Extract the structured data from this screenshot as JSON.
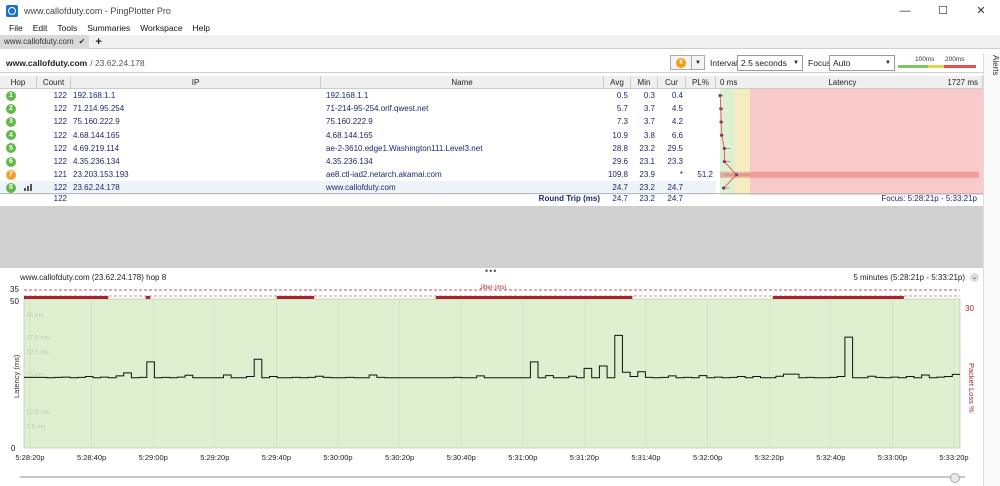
{
  "window": {
    "title": "www.callofduty.com - PingPlotter Pro",
    "minimize": "—",
    "maximize": "☐",
    "close": "✕"
  },
  "menu": [
    "File",
    "Edit",
    "Tools",
    "Summaries",
    "Workspace",
    "Help"
  ],
  "tab": {
    "label": "www.callofduty.com",
    "add": "+"
  },
  "target": {
    "name": "www.callofduty.com",
    "ip": " / 23.62.24.178"
  },
  "controls": {
    "interval_label": "Interval",
    "interval_value": "2.5 seconds",
    "focus_label": "Focus",
    "focus_value": "Auto",
    "scale_100": "100ms",
    "scale_200": "200ms",
    "alerts": "Alerts"
  },
  "table": {
    "headers": {
      "hop": "Hop",
      "count": "Count",
      "ip": "IP",
      "name": "Name",
      "avg": "Avg",
      "min": "Min",
      "cur": "Cur",
      "pl": "PL%",
      "lat0": "0 ms",
      "latency": "Latency",
      "latmax": "1727 ms"
    },
    "rows": [
      {
        "hop": "1",
        "count": "122",
        "ip": "192.168.1.1",
        "name": "192.168.1.1",
        "avg": "0.5",
        "min": "0.3",
        "cur": "0.4",
        "pl": "",
        "status": "ok"
      },
      {
        "hop": "2",
        "count": "122",
        "ip": "71.214.95.254",
        "name": "71-214-95-254.orlf.qwest.net",
        "avg": "5.7",
        "min": "3.7",
        "cur": "4.5",
        "pl": "",
        "status": "ok"
      },
      {
        "hop": "3",
        "count": "122",
        "ip": "75.160.222.9",
        "name": "75.160.222.9",
        "avg": "7.3",
        "min": "3.7",
        "cur": "4.2",
        "pl": "",
        "status": "ok"
      },
      {
        "hop": "4",
        "count": "122",
        "ip": "4.68.144.165",
        "name": "4.68.144.165",
        "avg": "10.9",
        "min": "3.8",
        "cur": "6.6",
        "pl": "",
        "status": "ok"
      },
      {
        "hop": "5",
        "count": "122",
        "ip": "4.69.219.114",
        "name": "ae-2-3610.edge1.Washington111.Level3.net",
        "avg": "28.8",
        "min": "23.2",
        "cur": "29.5",
        "pl": "",
        "status": "ok"
      },
      {
        "hop": "6",
        "count": "122",
        "ip": "4.35.236.134",
        "name": "4.35.236.134",
        "avg": "29.6",
        "min": "23.1",
        "cur": "23.3",
        "pl": "",
        "status": "ok"
      },
      {
        "hop": "7",
        "count": "121",
        "ip": "23.203.153.193",
        "name": "ae8.ctl-iad2.netarch.akamai.com",
        "avg": "109.8",
        "min": "23.9",
        "cur": "*",
        "pl": "51.2",
        "status": "warn"
      },
      {
        "hop": "8",
        "count": "122",
        "ip": "23.62.24.178",
        "name": "www.callofduty.com",
        "avg": "24.7",
        "min": "23.2",
        "cur": "24.7",
        "pl": "",
        "status": "ok"
      }
    ],
    "summary": {
      "count": "122",
      "label": "Round Trip (ms)",
      "avg": "24.7",
      "min": "23.2",
      "cur": "24.7",
      "focus": "Focus: 5:28:21p - 5:33:21p"
    }
  },
  "graph": {
    "title": "www.callofduty.com (23.62.24.178) hop 8",
    "range": "5 minutes (5:28:21p - 5:33:21p)",
    "range_btn": "⌄",
    "jitter_label": "Jitter (ms)",
    "jitter_max": "35",
    "y_max": "50",
    "y_zero": "0",
    "loss_max": "30",
    "y_label": "Latency (ms)",
    "loss_label": "Packet Loss %",
    "y_ticks_faint": [
      "45 ms",
      "37.5 ms",
      "32.5 ms",
      "25 ms",
      "12.5 ms",
      "7.5 ms"
    ],
    "x_ticks": [
      "5:28:20p",
      "5:28:40p",
      "5:29:00p",
      "5:29:20p",
      "5:29:40p",
      "5:30:00p",
      "5:30:20p",
      "5:30:40p",
      "5:31:00p",
      "5:31:20p",
      "5:31:40p",
      "5:32:00p",
      "5:32:20p",
      "5:32:40p",
      "5:33:00p",
      "5:33:20p"
    ]
  },
  "chart_data": {
    "type": "line",
    "title": "www.callofduty.com (23.62.24.178) hop 8",
    "xlabel": "",
    "ylabel": "Latency (ms)",
    "ylim": [
      0,
      50
    ],
    "x_range": [
      "5:28:21p",
      "5:33:21p"
    ],
    "series": [
      {
        "values": [
          23.7,
          23.7,
          23.7,
          23.6,
          23.7,
          23.8,
          23.6,
          23.7,
          24.0,
          23.6,
          23.8,
          23.6,
          24.2,
          25.2,
          23.6,
          23.7,
          28.9,
          23.6,
          23.7,
          23.6,
          23.8,
          24.4,
          23.6,
          23.6,
          23.6,
          23.6,
          24.5,
          23.6,
          23.6,
          24.0,
          29.8,
          23.6,
          24.0,
          23.6,
          23.6,
          23.7,
          23.6,
          23.7,
          24.1,
          23.7,
          23.6,
          23.6,
          23.7,
          23.6,
          23.6,
          24.5,
          23.7,
          23.6,
          23.6,
          23.6,
          23.6,
          23.6,
          23.6,
          23.6,
          23.6,
          23.6,
          23.7,
          23.6,
          23.6,
          24.2,
          23.6,
          23.6,
          23.6,
          23.6,
          23.6,
          23.6,
          28.9,
          23.6,
          24.3,
          23.6,
          23.6,
          24.1,
          23.6,
          26.7,
          23.6,
          27.5,
          23.6,
          37.8,
          25.4,
          24.0,
          25.6,
          23.7,
          23.6,
          23.7,
          24.2,
          23.6,
          23.7,
          23.6,
          24.3,
          23.6,
          23.8,
          23.6,
          23.7,
          24.0,
          23.6,
          24.0,
          23.6,
          23.6,
          24.1,
          24.8,
          24.8,
          23.6,
          23.7,
          23.6,
          23.6,
          23.7,
          24.0,
          37.2,
          23.6,
          23.6,
          24.1,
          23.7,
          23.6,
          23.8,
          23.6,
          24.0,
          23.6,
          24.5,
          23.6,
          23.8,
          24.0,
          24.7
        ]
      }
    ],
    "jitter_threshold": 35,
    "packet_loss_max": 30,
    "jitter_segments": [
      [
        0.0,
        0.09
      ],
      [
        0.13,
        0.135
      ],
      [
        0.27,
        0.31
      ],
      [
        0.44,
        0.65
      ],
      [
        0.8,
        0.94
      ]
    ]
  },
  "colors": {
    "ok": "#62b74a",
    "warn": "#f0a030",
    "graph_bg": "#dff0d0",
    "latency_red": "#f8caca",
    "jitter": "#a8242c",
    "line": "#111111"
  }
}
